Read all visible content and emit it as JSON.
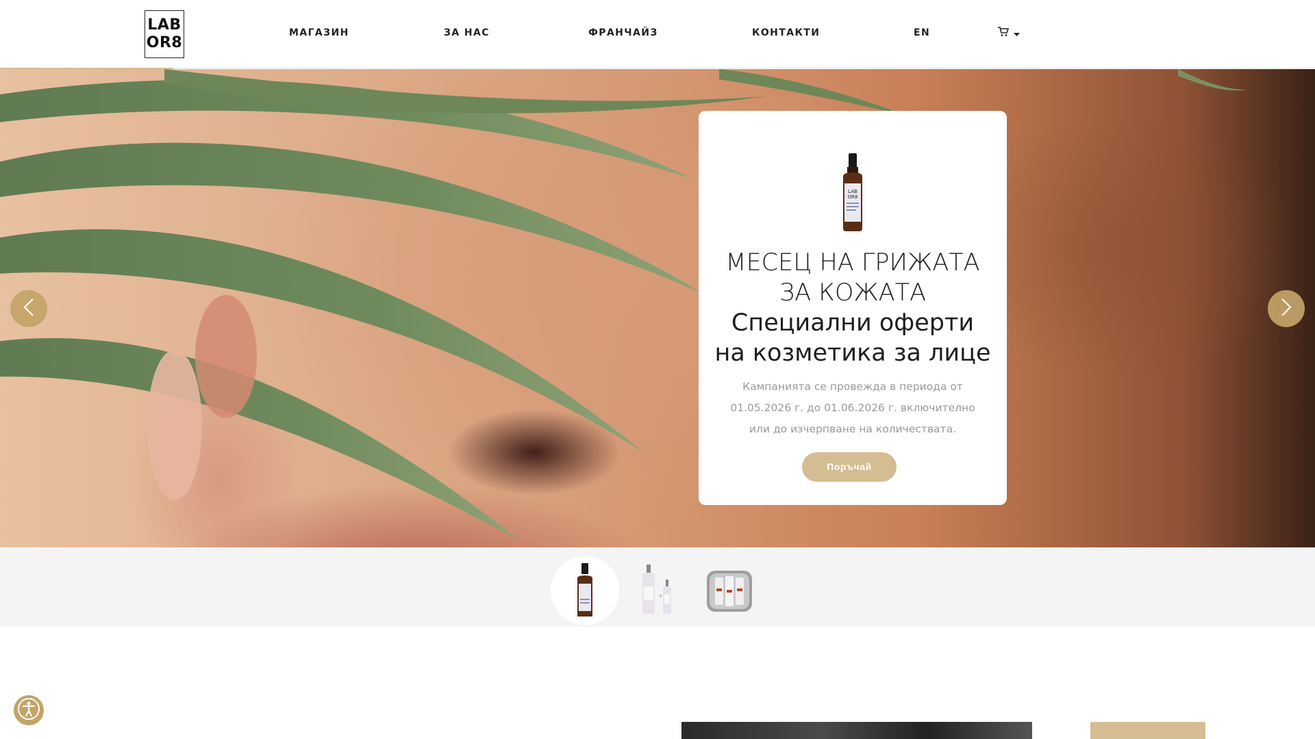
{
  "brand": {
    "logo_line1": "LAB",
    "logo_line2": "OR8"
  },
  "nav": {
    "shop": "МАГАЗИН",
    "about": "ЗА НАС",
    "franchise": "ФРАНЧАЙЗ",
    "contacts": "КОНТАКТИ",
    "language": "EN"
  },
  "icons": {
    "cart": "cart-icon",
    "caret": "caret-down-icon",
    "prev": "chevron-left-icon",
    "next": "chevron-right-icon",
    "accessibility": "accessibility-icon"
  },
  "colors": {
    "accent_gold": "#d4bd92",
    "arrow_gold": "#c4a468",
    "a11y_gold": "#c3a466"
  },
  "hero": {
    "title_line1": "МЕСЕЦ НА ГРИЖАТА",
    "title_line2": "ЗА КОЖАТА",
    "subtitle_line1": "Специални оферти",
    "subtitle_line2": "на козметика за лице",
    "description": "Кампанията се провежда в периода от 01.05.2026 г. до 01.06.2026 г. включително или до изчерпване на количествата.",
    "cta": "Поръчай"
  },
  "slider": {
    "active_slide": 1,
    "slide_count": 3
  }
}
